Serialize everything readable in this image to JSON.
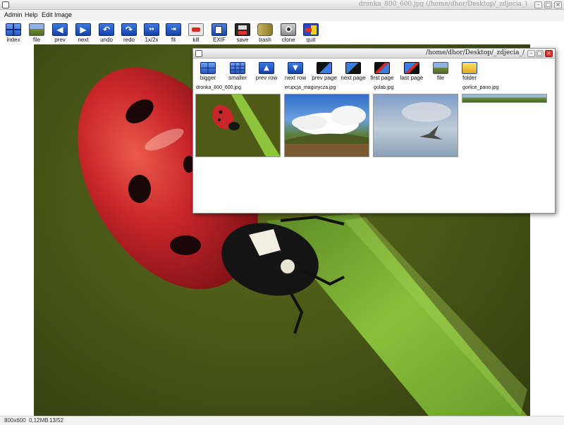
{
  "window": {
    "title": "dronka_800_600.jpg (/home/dhor/Desktop/_zdjecia_)"
  },
  "menu": [
    "Admin",
    "Help",
    "Edit Image"
  ],
  "toolbar": [
    {
      "label": "index",
      "icon": "index-grid-icon"
    },
    {
      "label": "file",
      "icon": "file-landscape-icon"
    },
    {
      "label": "prev",
      "icon": "arrow-left-icon"
    },
    {
      "label": "next",
      "icon": "arrow-right-icon"
    },
    {
      "label": "undo",
      "icon": "undo-icon"
    },
    {
      "label": "redo",
      "icon": "redo-icon"
    },
    {
      "label": "1x/2x",
      "icon": "zoom-toggle-icon"
    },
    {
      "label": "fit",
      "icon": "fit-icon"
    },
    {
      "label": "kill",
      "icon": "kill-icon"
    },
    {
      "label": "EXIF",
      "icon": "exif-icon"
    },
    {
      "label": "save",
      "icon": "floppy-disk-icon"
    },
    {
      "label": "trash",
      "icon": "trash-icon"
    },
    {
      "label": "clone",
      "icon": "camera-icon"
    },
    {
      "label": "quit",
      "icon": "quit-door-icon"
    }
  ],
  "status": {
    "dimensions": "800x600",
    "filesize": "0,12MB",
    "position": "13/52"
  },
  "index_window": {
    "title": "/home/dhor/Desktop/_zdjecia_/",
    "toolbar": [
      {
        "label": "bigger",
        "icon": "grid-bigger-icon"
      },
      {
        "label": "smaller",
        "icon": "grid-smaller-icon"
      },
      {
        "label": "prev row",
        "icon": "prev-row-icon"
      },
      {
        "label": "next row",
        "icon": "next-row-icon"
      },
      {
        "label": "prev page",
        "icon": "prev-page-icon"
      },
      {
        "label": "next page",
        "icon": "next-page-icon"
      },
      {
        "label": "first page",
        "icon": "first-page-icon"
      },
      {
        "label": "last page",
        "icon": "last-page-icon"
      },
      {
        "label": "file",
        "icon": "file-landscape-icon"
      },
      {
        "label": "folder",
        "icon": "folder-icon"
      }
    ],
    "thumbnails": [
      {
        "name": "dronka_800_600.jpg"
      },
      {
        "name": "erupcja_magurycza.jpg"
      },
      {
        "name": "golab.jpg"
      },
      {
        "name": "gorlice_pano.jpg"
      }
    ]
  },
  "colors": {
    "photo_background": "#4c5a17",
    "ladybug_red": "#c8262a",
    "grass_green": "#86c23a",
    "toolbar_blue": "#1c56c8"
  }
}
